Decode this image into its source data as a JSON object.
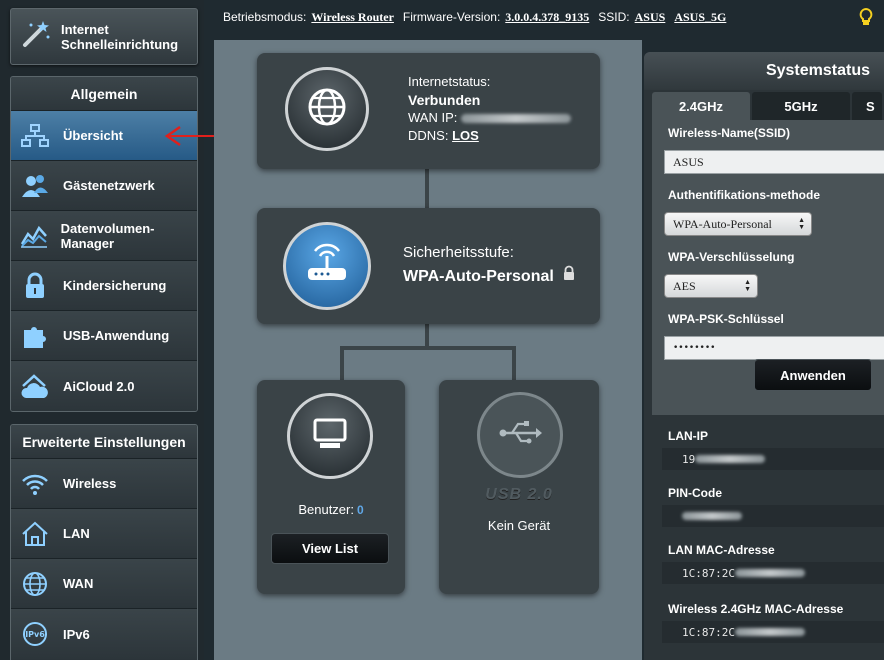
{
  "sidebar": {
    "quick_setup": "Internet Schnelleinrichtung",
    "general": {
      "heading": "Allgemein",
      "items": [
        "Übersicht",
        "Gästenetzwerk",
        "Datenvolumen-Manager",
        "Kindersicherung",
        "USB-Anwendung",
        "AiCloud 2.0"
      ]
    },
    "advanced": {
      "heading": "Erweiterte Einstellungen",
      "items": [
        "Wireless",
        "LAN",
        "WAN",
        "IPv6"
      ]
    }
  },
  "topbar": {
    "mode_label": "Betriebsmodus:",
    "mode_value": "Wireless Router",
    "firmware_label": "Firmware-Version:",
    "firmware_value": "3.0.0.4.378_9135",
    "ssid_label": "SSID:",
    "ssid_1": "ASUS",
    "ssid_2": "ASUS_5G"
  },
  "internet": {
    "status_label": "Internetstatus:",
    "status_value": "Verbunden",
    "wan_ip_label": "WAN IP:",
    "ddns_label": "DDNS:",
    "ddns_value": "LOS"
  },
  "security": {
    "label": "Sicherheitsstufe:",
    "value": "WPA-Auto-Personal"
  },
  "clients": {
    "label": "Benutzer:",
    "count": "0",
    "button": "View List"
  },
  "usb": {
    "label": "USB 2.0",
    "status": "Kein Gerät"
  },
  "system_status": {
    "title": "Systemstatus",
    "tabs": [
      "2.4GHz",
      "5GHz",
      "S"
    ],
    "ssid_label": "Wireless-Name(SSID)",
    "ssid_value": "ASUS",
    "auth_label": "Authentifikations-methode",
    "auth_value": "WPA-Auto-Personal",
    "enc_label": "WPA-Verschlüsselung",
    "enc_value": "AES",
    "psk_label": "WPA-PSK-Schlüssel",
    "psk_value": "••••••••",
    "apply_button": "Anwenden",
    "lan_ip_label": "LAN-IP",
    "lan_ip_value": "19",
    "pin_label": "PIN-Code",
    "lan_mac_label": "LAN MAC-Adresse",
    "lan_mac_value": "1C:87:2C",
    "wl_mac_label": "Wireless 2.4GHz MAC-Adresse",
    "wl_mac_value": "1C:87:2C"
  },
  "colors": {
    "accent_blue": "#265a86",
    "arrow_red": "#e0201c",
    "client_count": "#60a8e8"
  }
}
